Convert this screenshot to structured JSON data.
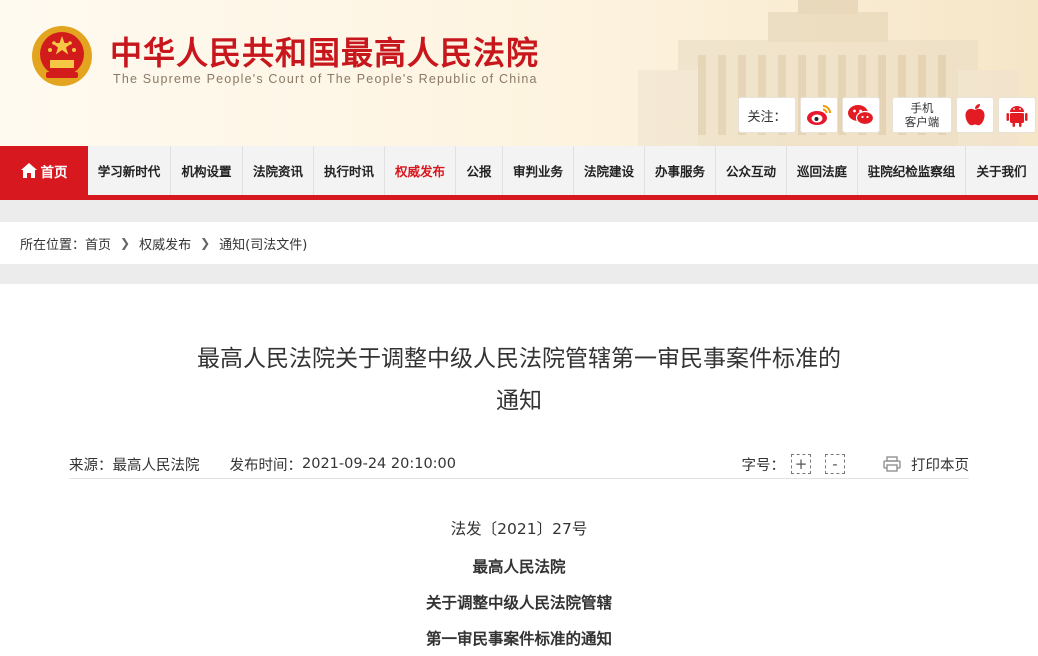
{
  "header": {
    "title": "中华人民共和国最高人民法院",
    "subtitle": "The Supreme People's Court of The People's Republic of China",
    "follow_label": "关注：",
    "mobile_link_line1": "手机",
    "mobile_link_line2": "客户端",
    "icons": [
      "weibo-icon",
      "wechat-icon",
      "apple-icon",
      "android-icon"
    ]
  },
  "nav": {
    "home": "首页",
    "items": [
      "学习新时代",
      "机构设置",
      "法院资讯",
      "执行时讯",
      "权威发布",
      "公报",
      "审判业务",
      "法院建设",
      "办事服务",
      "公众互动",
      "巡回法庭",
      "驻院纪检监察组",
      "关于我们"
    ],
    "active_index": 4
  },
  "breadcrumb": {
    "prefix": "所在位置：",
    "items": [
      "首页",
      "权威发布",
      "通知(司法文件)"
    ]
  },
  "article": {
    "title_line1": "最高人民法院关于调整中级人民法院管辖第一审民事案件标准的",
    "title_line2": "通知",
    "source_label": "来源：",
    "source": "最高人民法院",
    "time_label": "发布时间：",
    "time": "2021-09-24 20:10:00",
    "font_label": "字号：",
    "font_increase": "+",
    "font_decrease": "-",
    "print": "打印本页",
    "doc_number": "法发〔2021〕27号",
    "heading_line1": "最高人民法院",
    "heading_line2": "关于调整中级人民法院管辖",
    "heading_line3": "第一审民事案件标准的通知"
  },
  "colors": {
    "brand_red": "#d7191f",
    "title_red": "#c8161d",
    "nav_bg": "#f3f3f3",
    "header_bg": "#fdf3df"
  }
}
